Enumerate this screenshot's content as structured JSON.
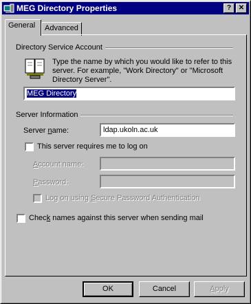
{
  "window": {
    "title": "MEG Directory Properties",
    "help_label": "?",
    "close_label": "✕"
  },
  "tabs": [
    {
      "label": "General",
      "active": true
    },
    {
      "label": "Advanced",
      "active": false
    }
  ],
  "directory_group": {
    "title": "Directory Service Account",
    "description": "Type the name by which you would like to refer to this server. For example, \"Work Directory\" or \"Microsoft Directory Server\".",
    "name_value": "MEG Directory"
  },
  "server_group": {
    "title": "Server Information",
    "server_name_label": "Server name:",
    "server_name_value": "ldap.ukoln.ac.uk",
    "requires_logon_label": "This server requires me to log on",
    "requires_logon_checked": false,
    "account_name_label": "Account name:",
    "account_name_value": "",
    "password_label": "Password:",
    "password_value": "",
    "spa_label": "Log on using Secure Password Authentication",
    "spa_checked": false
  },
  "check_names_label": "Check names against this server when sending mail",
  "check_names_checked": false,
  "buttons": {
    "ok": "OK",
    "cancel": "Cancel",
    "apply": "Apply"
  }
}
